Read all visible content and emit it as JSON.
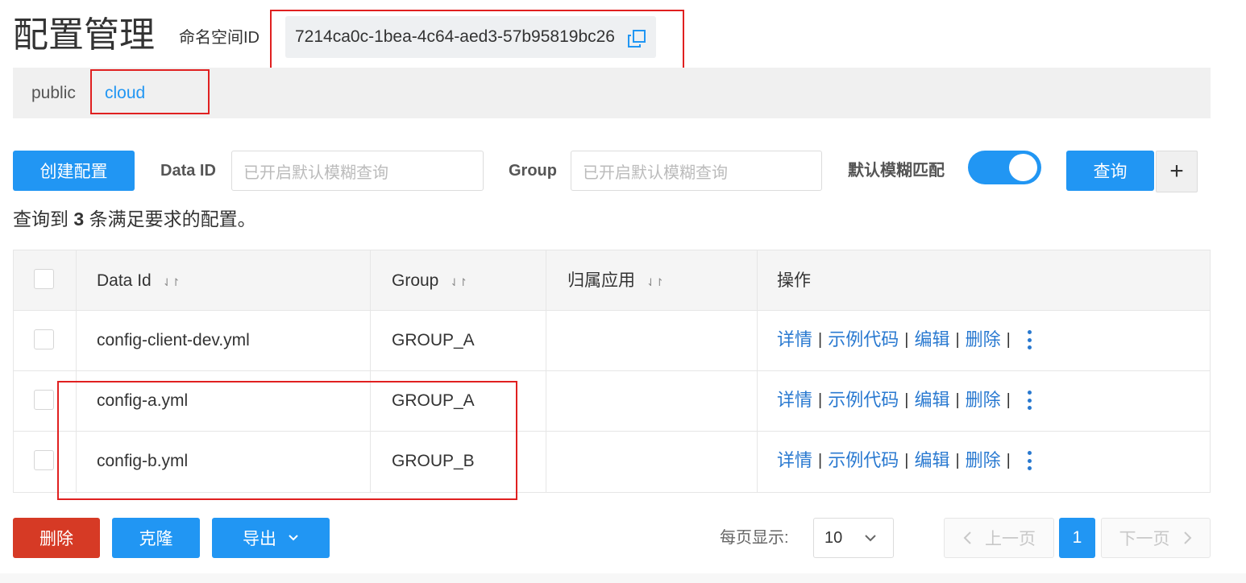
{
  "header": {
    "title": "配置管理",
    "namespace_label": "命名空间ID",
    "namespace_id": "7214ca0c-1bea-4c64-aed3-57b95819bc26"
  },
  "namespaces": [
    {
      "label": "public",
      "active": false
    },
    {
      "label": "cloud",
      "active": true
    }
  ],
  "toolbar": {
    "create_label": "创建配置",
    "data_id_label": "Data ID",
    "data_id_placeholder": "已开启默认模糊查询",
    "group_label": "Group",
    "group_placeholder": "已开启默认模糊查询",
    "fuzzy_label": "默认模糊匹配",
    "fuzzy_enabled": true,
    "query_label": "查询",
    "add_label": "+"
  },
  "summary": {
    "prefix": "查询到",
    "count": "3",
    "suffix": "条满足要求的配置。"
  },
  "table": {
    "columns": [
      "Data Id",
      "Group",
      "归属应用",
      "操作"
    ],
    "rows": [
      {
        "data_id": "config-client-dev.yml",
        "group": "GROUP_A",
        "app": ""
      },
      {
        "data_id": "config-a.yml",
        "group": "GROUP_A",
        "app": ""
      },
      {
        "data_id": "config-b.yml",
        "group": "GROUP_B",
        "app": ""
      }
    ],
    "actions": {
      "detail": "详情",
      "sample": "示例代码",
      "edit": "编辑",
      "delete": "删除",
      "separator": "|"
    }
  },
  "footer": {
    "delete_label": "删除",
    "clone_label": "克隆",
    "export_label": "导出",
    "page_size_label": "每页显示:",
    "page_size": "10",
    "prev_label": "上一页",
    "current_page": "1",
    "next_label": "下一页"
  },
  "colors": {
    "primary": "#2196f3",
    "danger": "#d63a25",
    "link": "#2979d0",
    "annotation": "#e02020"
  },
  "icons": {
    "copy": "copy-icon",
    "sort": "sort-icon",
    "more": "more-vertical-icon",
    "chevron_down": "chevron-down-icon",
    "chevron_left": "chevron-left-icon",
    "chevron_right": "chevron-right-icon",
    "plus": "plus-icon"
  }
}
